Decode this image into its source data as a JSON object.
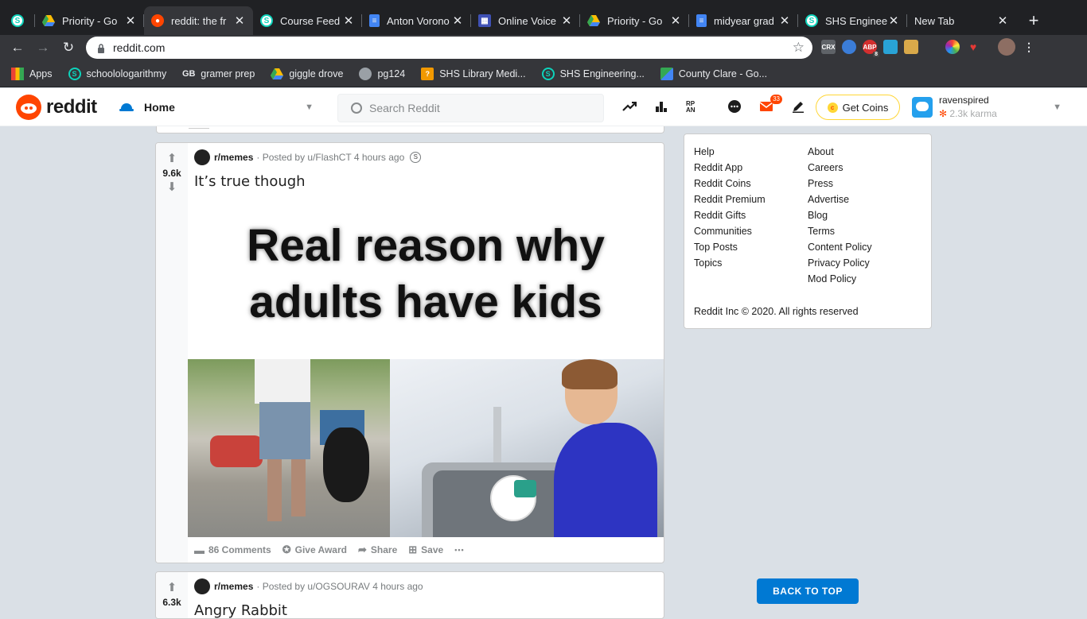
{
  "browser": {
    "tabs": [
      {
        "title": "",
        "icon": "reddit-s-icon",
        "color": "#0dd3bb"
      },
      {
        "title": "Priority - Go",
        "icon": "drive-icon",
        "color": "#34a853"
      },
      {
        "title": "reddit: the fr",
        "icon": "reddit-icon",
        "color": "#ff4500",
        "active": true
      },
      {
        "title": "Course Feed",
        "icon": "schoology-icon",
        "color": "#0dd3bb"
      },
      {
        "title": "Anton Vorono",
        "icon": "docs-icon",
        "color": "#4285f4"
      },
      {
        "title": "Online Voice",
        "icon": "voice-icon",
        "color": "#3f51b5"
      },
      {
        "title": "Priority - Go",
        "icon": "drive-icon",
        "color": "#34a853"
      },
      {
        "title": "midyear grad",
        "icon": "docs-icon",
        "color": "#4285f4"
      },
      {
        "title": "SHS Enginee",
        "icon": "schoology-icon",
        "color": "#0dd3bb"
      },
      {
        "title": "New Tab",
        "icon": "",
        "color": ""
      }
    ],
    "new_tab": "+",
    "url": "reddit.com",
    "extensions": [
      {
        "name": "crx-icon",
        "label": "CRX",
        "color": "#5f6368"
      },
      {
        "name": "owl-icon",
        "label": "",
        "color": "#3b7dd8"
      },
      {
        "name": "abp-icon",
        "label": "ABP",
        "color": "#d32f2f"
      },
      {
        "name": "extension-icon",
        "label": "",
        "color": "#29a3d6"
      },
      {
        "name": "box-icon",
        "label": "",
        "color": "#d9a94a"
      },
      {
        "name": "leaf-icon",
        "label": "",
        "color": "#35363a"
      },
      {
        "name": "color-icon",
        "label": "",
        "color": "#9c27b0"
      },
      {
        "name": "heart-icon",
        "label": "",
        "color": "#e53935"
      }
    ],
    "ext_badge": "8",
    "bookmarks": [
      {
        "label": "Apps",
        "icon": "apps-grid-icon",
        "color": "#ea4335"
      },
      {
        "label": "schoolologarithmy",
        "icon": "schoology-icon",
        "color": "#0dd3bb"
      },
      {
        "label": "gramer prep",
        "icon": "gb-icon",
        "color": "#222222"
      },
      {
        "label": "giggle drove",
        "icon": "drive-icon",
        "color": "#34a853"
      },
      {
        "label": "pg124",
        "icon": "globe-icon",
        "color": "#9aa0a6"
      },
      {
        "label": "SHS Library Medi...",
        "icon": "library-icon",
        "color": "#f29900"
      },
      {
        "label": "SHS Engineering...",
        "icon": "schoology-icon",
        "color": "#0dd3bb"
      },
      {
        "label": "County Clare - Go...",
        "icon": "maps-icon",
        "color": "#34a853"
      }
    ]
  },
  "reddit": {
    "logo_text": "reddit",
    "home_label": "Home",
    "search_placeholder": "Search Reddit",
    "notif_count": "33",
    "get_coins": "Get Coins",
    "username": "ravenspired",
    "karma": "2.3k karma",
    "brand_color": "#ff4500",
    "accent_color": "#0079d3"
  },
  "posts": [
    {
      "score": "9.6k",
      "subreddit": "r/memes",
      "posted_by": "· Posted by u/FlashCT 4 hours ago",
      "title": "It’s true though",
      "meme_text": "Real reason why adults have kids",
      "comments": "86 Comments",
      "give_award": "Give Award",
      "share": "Share",
      "save": "Save",
      "more": "•••"
    },
    {
      "score": "6.3k",
      "subreddit": "r/memes",
      "posted_by": "· Posted by u/OGSOURAV 4 hours ago",
      "title": "Angry Rabbit"
    }
  ],
  "sidebar": {
    "col1": [
      "Help",
      "Reddit App",
      "Reddit Coins",
      "Reddit Premium",
      "Reddit Gifts",
      "Communities",
      "Top Posts",
      "Topics"
    ],
    "col2": [
      "About",
      "Careers",
      "Press",
      "Advertise",
      "Blog",
      "Terms",
      "Content Policy",
      "Privacy Policy",
      "Mod Policy"
    ],
    "copyright": "Reddit Inc © 2020. All rights reserved"
  },
  "back_to_top": "BACK TO TOP"
}
